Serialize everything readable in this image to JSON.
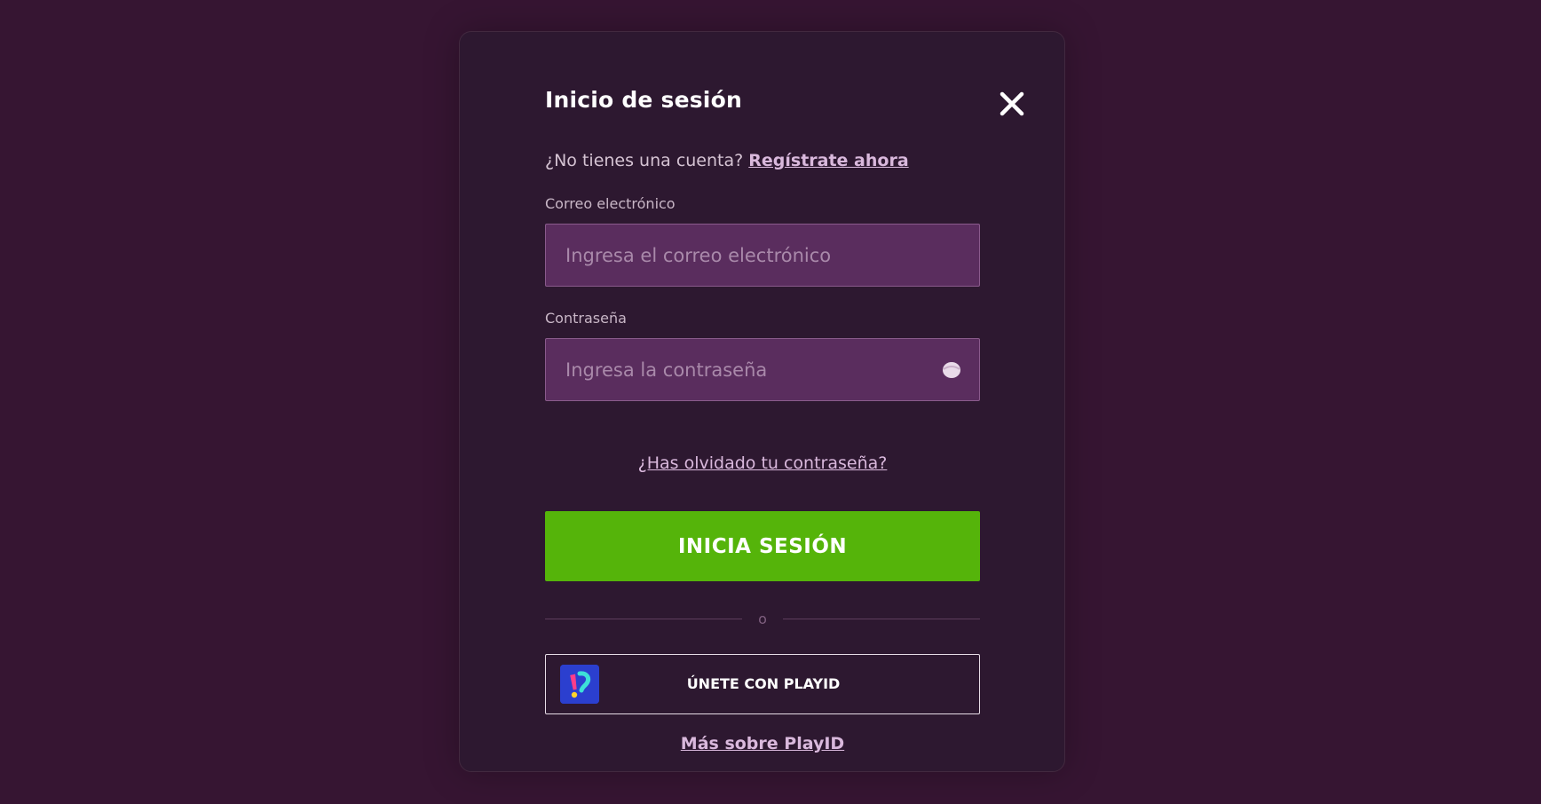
{
  "login": {
    "title": "Inicio de sesión",
    "no_account_text": "¿No tienes una cuenta?",
    "register_link": "Regístrate ahora",
    "email": {
      "label": "Correo electrónico",
      "placeholder": "Ingresa el correo electrónico",
      "value": ""
    },
    "password": {
      "label": "Contraseña",
      "placeholder": "Ingresa la contraseña",
      "value": ""
    },
    "forgot_password": "¿Has olvidado tu contraseña?",
    "submit_label": "INICIA SESIÓN",
    "divider_text": "o",
    "playid_button_label": "ÚNETE CON PLAYID",
    "more_playid_link": "Más sobre PlayID"
  },
  "icons": {
    "close": "close-icon",
    "password_toggle": "eye-icon",
    "playid_logo": "playid-logo-icon"
  },
  "colors": {
    "page_background": "#361532",
    "modal_background": "#2d1830",
    "input_background": "#5a2d5e",
    "primary_button": "#55b40a",
    "link": "#d9b8dc"
  }
}
